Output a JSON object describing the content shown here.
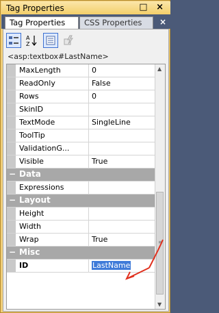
{
  "window": {
    "title": "Tag Properties",
    "controls": "□ ×"
  },
  "tabs": [
    {
      "label": "Tag Properties",
      "active": true
    },
    {
      "label": "CSS Properties",
      "active": false
    }
  ],
  "tab_close": "×",
  "toolbar": {
    "buttons": [
      {
        "name": "categorized-icon",
        "glyph": "☷"
      },
      {
        "name": "sort-alpha-icon",
        "glyph": "A↓Z"
      },
      {
        "name": "properties-icon",
        "glyph": "☰"
      },
      {
        "name": "events-icon",
        "glyph": "⚡"
      }
    ]
  },
  "selector": "<asp:textbox#LastName>",
  "grid": {
    "rows": [
      {
        "type": "prop",
        "name": "MaxLength",
        "value": "0"
      },
      {
        "type": "prop",
        "name": "ReadOnly",
        "value": "False"
      },
      {
        "type": "prop",
        "name": "Rows",
        "value": "0"
      },
      {
        "type": "prop",
        "name": "SkinID",
        "value": ""
      },
      {
        "type": "prop",
        "name": "TextMode",
        "value": "SingleLine"
      },
      {
        "type": "prop",
        "name": "ToolTip",
        "value": ""
      },
      {
        "type": "prop",
        "name": "ValidationG...",
        "value": ""
      },
      {
        "type": "prop",
        "name": "Visible",
        "value": "True"
      },
      {
        "type": "cat",
        "name": "Data"
      },
      {
        "type": "prop",
        "name": "Expressions",
        "value": ""
      },
      {
        "type": "cat",
        "name": "Layout"
      },
      {
        "type": "prop",
        "name": "Height",
        "value": ""
      },
      {
        "type": "prop",
        "name": "Width",
        "value": ""
      },
      {
        "type": "prop",
        "name": "Wrap",
        "value": "True"
      },
      {
        "type": "cat",
        "name": "Misc"
      },
      {
        "type": "prop",
        "name": "ID",
        "value": "LastName",
        "selected": true
      }
    ]
  },
  "colors": {
    "accent": "#3f7bd9",
    "arrow": "#e0301e",
    "titlebar": "#f3cf6a"
  }
}
